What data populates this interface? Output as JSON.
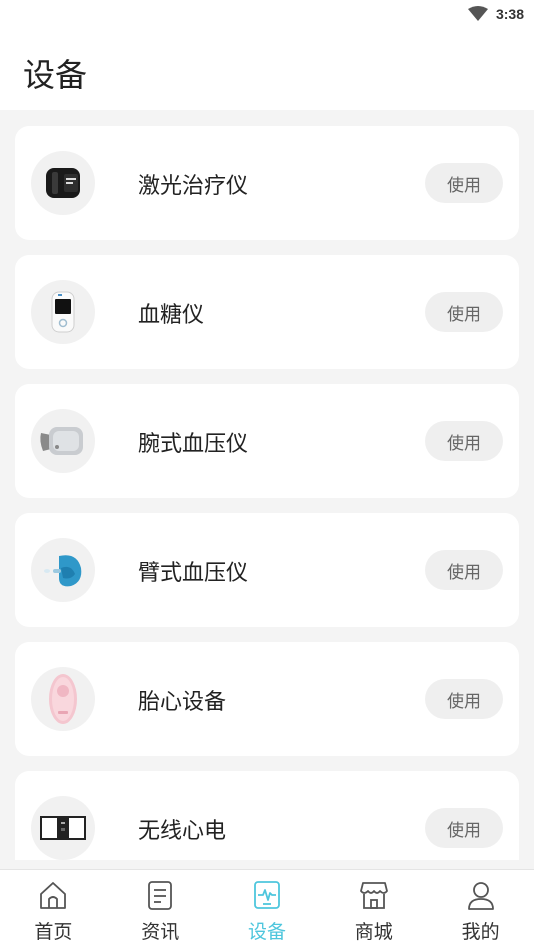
{
  "status_bar": {
    "time": "3:38"
  },
  "header": {
    "title": "设备"
  },
  "devices": [
    {
      "name": "激光治疗仪",
      "button": "使用",
      "icon": "watch-device-icon"
    },
    {
      "name": "血糖仪",
      "button": "使用",
      "icon": "glucose-meter-icon"
    },
    {
      "name": "腕式血压仪",
      "button": "使用",
      "icon": "wrist-bp-monitor-icon"
    },
    {
      "name": "臂式血压仪",
      "button": "使用",
      "icon": "arm-bp-monitor-icon"
    },
    {
      "name": "胎心设备",
      "button": "使用",
      "icon": "fetal-doppler-icon"
    },
    {
      "name": "无线心电",
      "button": "使用",
      "icon": "wireless-ecg-icon"
    }
  ],
  "tabbar": {
    "items": [
      {
        "label": "首页",
        "icon": "home-icon",
        "active": false
      },
      {
        "label": "资讯",
        "icon": "document-icon",
        "active": false
      },
      {
        "label": "设备",
        "icon": "device-pulse-icon",
        "active": true
      },
      {
        "label": "商城",
        "icon": "shop-icon",
        "active": false
      },
      {
        "label": "我的",
        "icon": "user-icon",
        "active": false
      }
    ]
  },
  "colors": {
    "accent": "#4ec6dd",
    "background": "#f4f4f4",
    "card": "#ffffff"
  }
}
